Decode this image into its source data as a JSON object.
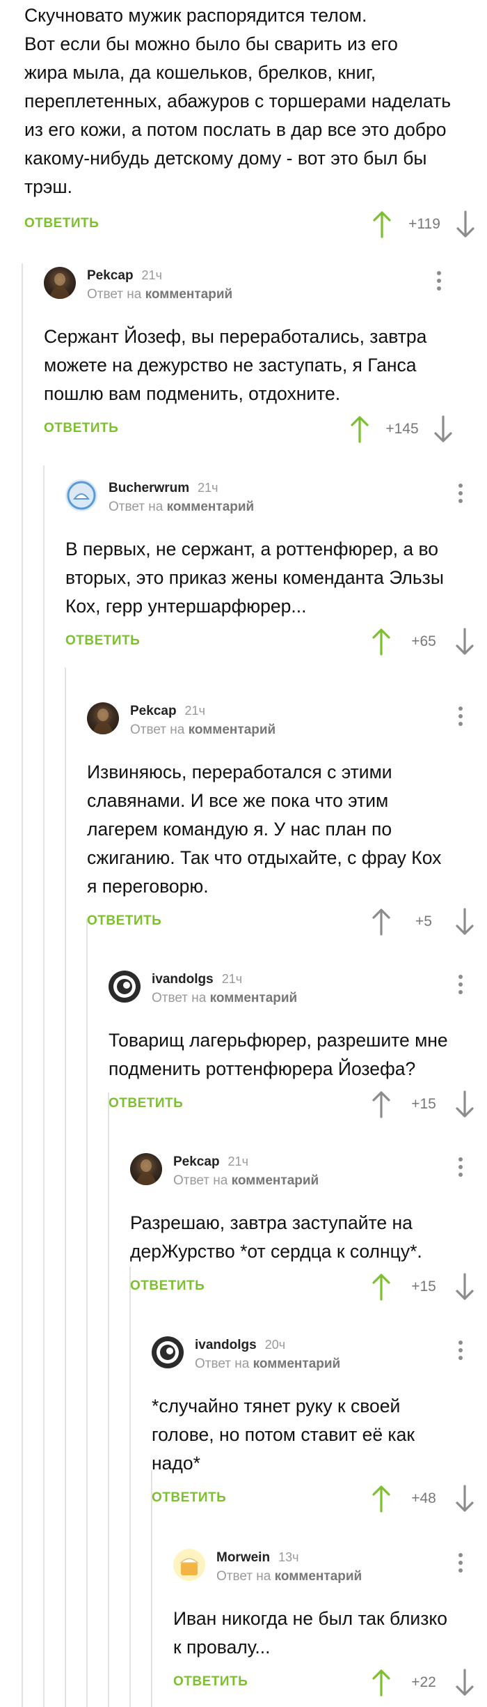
{
  "top": {
    "text_lines": [
      "Скучновато мужик распорядится телом.",
      "Вот если бы можно было бы сварить из его",
      "жира мыла, да кошельков, брелков, книг,",
      "переплетенных, абажуров с торшерами наделать",
      "из его кожи, а потом послать в дар все это добро",
      "какому-нибудь детскому дому - вот это был бы",
      "трэш."
    ],
    "reply_label": "ОТВЕТИТЬ",
    "score": "+119",
    "upvoted": true
  },
  "labels": {
    "reply_to_prefix": "Ответ на",
    "reply_to_link": "комментарий"
  },
  "comments": [
    {
      "author": "Pekcap",
      "time": "21ч",
      "avatar": "reksar-avatar",
      "text_lines": [
        "Сержант Йозеф, вы переработались, завтра",
        "можете на дежурство не заступать, я Ганса",
        "пошлю вам подменить, отдохните."
      ],
      "reply_label": "ОТВЕТИТЬ",
      "score": "+145",
      "upvoted": true
    },
    {
      "author": "Bucherwrum",
      "time": "21ч",
      "avatar": "bucherwrum-avatar",
      "text_lines": [
        "В первых, не сержант, а роттенфюрер, а во",
        "вторых, это приказ жены коменданта Эльзы",
        "Кох, герр унтершарфюрер..."
      ],
      "reply_label": "ОТВЕТИТЬ",
      "score": "+65",
      "upvoted": true
    },
    {
      "author": "Pekcap",
      "time": "21ч",
      "avatar": "reksar-avatar",
      "text_lines": [
        "Извиняюсь, переработался с этими",
        "славянами. И все же пока что этим",
        "лагерем командую я. У нас план по",
        "сжиганию. Так что отдыхайте, с фрау Кох",
        "я переговорю."
      ],
      "reply_label": "ОТВЕТИТЬ",
      "score": "+5",
      "upvoted": false
    },
    {
      "author": "ivandolgs",
      "time": "21ч",
      "avatar": "ivandolgs-avatar",
      "text_lines": [
        "Товарищ лагерьфюрер, разрешите мне",
        "подменить роттенфюрера Йозефа?"
      ],
      "reply_label": "ОТВЕТИТЬ",
      "score": "+15",
      "upvoted": false
    },
    {
      "author": "Pekcap",
      "time": "21ч",
      "avatar": "reksar-avatar",
      "text_lines": [
        "Разрешаю, завтра заступайте на",
        "дерЖурство *от сердца к солнцу*."
      ],
      "reply_label": "ОТВЕТИТЬ",
      "score": "+15",
      "upvoted": true
    },
    {
      "author": "ivandolgs",
      "time": "20ч",
      "avatar": "ivandolgs-avatar",
      "text_lines": [
        "*случайно тянет руку к своей",
        "голове, но потом ставит её как",
        "надо*"
      ],
      "reply_label": "ОТВЕТИТЬ",
      "score": "+48",
      "upvoted": true
    },
    {
      "author": "Morwein",
      "time": "13ч",
      "avatar": "morwein-avatar",
      "text_lines": [
        "Иван никогда не был так близко",
        "к провалу..."
      ],
      "reply_label": "ОТВЕТИТЬ",
      "score": "+22",
      "upvoted": true
    }
  ],
  "colors": {
    "accent_green": "#7cbf2f",
    "icon_gray": "#8c8c8c",
    "thread_line": "#e2e2e2",
    "muted_text": "#9a9a9a"
  }
}
